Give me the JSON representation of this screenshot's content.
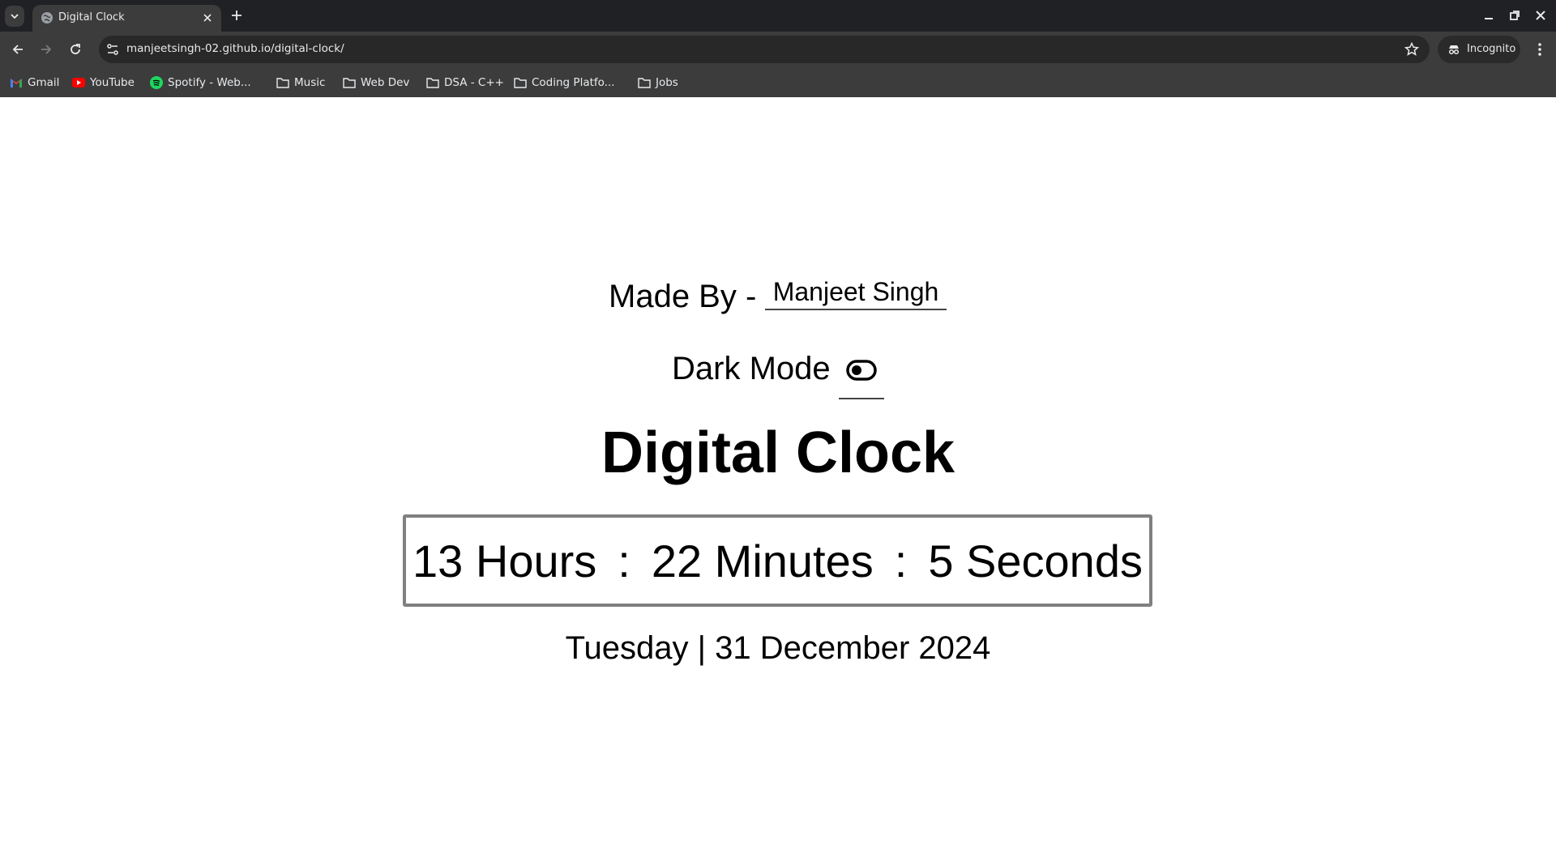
{
  "browser": {
    "tab_title": "Digital Clock",
    "url": "manjeetsingh-02.github.io/digital-clock/",
    "incognito_label": "Incognito",
    "bookmarks": [
      {
        "label": "Gmail",
        "icon": "gmail-icon"
      },
      {
        "label": "YouTube",
        "icon": "youtube-icon"
      },
      {
        "label": "Spotify - Web...",
        "icon": "spotify-icon"
      },
      {
        "label": "Music",
        "icon": "folder-icon"
      },
      {
        "label": "Web Dev",
        "icon": "folder-icon"
      },
      {
        "label": "DSA - C++",
        "icon": "folder-icon"
      },
      {
        "label": "Coding Platfo...",
        "icon": "folder-icon"
      },
      {
        "label": "Jobs",
        "icon": "folder-icon"
      }
    ]
  },
  "page": {
    "made_by_label": "Made By -",
    "author_name": "Manjeet Singh",
    "dark_mode_label": "Dark Mode",
    "title": "Digital Clock",
    "clock": {
      "hours": "13 Hours",
      "minutes": "22 Minutes",
      "seconds": "5 Seconds",
      "separator": ":"
    },
    "date": "Tuesday | 31 December 2024"
  },
  "colors": {
    "tabstrip_bg": "#202124",
    "toolbar_bg": "#3c3c3c",
    "page_bg": "#ffffff",
    "clock_border": "#808080"
  }
}
